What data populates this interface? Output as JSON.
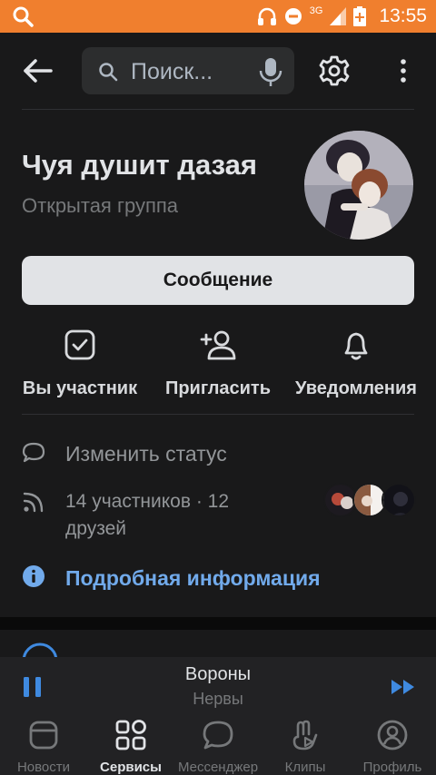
{
  "status_bar": {
    "time": "13:55",
    "network": "3G"
  },
  "header": {
    "search_placeholder": "Поиск..."
  },
  "group": {
    "name": "Чуя душит дазая",
    "type": "Открытая группа",
    "message_button": "Сообщение"
  },
  "actions": [
    {
      "label": "Вы участник",
      "icon": "member-check-icon"
    },
    {
      "label": "Пригласить",
      "icon": "add-person-icon"
    },
    {
      "label": "Уведомления",
      "icon": "bell-icon"
    }
  ],
  "info": {
    "status": "Изменить статус",
    "members": "14 участников · 12 друзей",
    "details": "Подробная информация"
  },
  "player": {
    "title": "Вороны",
    "artist": "Нервы"
  },
  "tabs": [
    {
      "label": "Новости",
      "icon": "news-icon"
    },
    {
      "label": "Сервисы",
      "icon": "services-icon",
      "active": true
    },
    {
      "label": "Мессенджер",
      "icon": "messenger-icon"
    },
    {
      "label": "Клипы",
      "icon": "clips-icon"
    },
    {
      "label": "Профиль",
      "icon": "profile-icon"
    }
  ],
  "colors": {
    "status_bar": "#f07f2e",
    "background": "#19191a",
    "accent": "#71aaeb",
    "player_accent": "#3f8ae0"
  }
}
